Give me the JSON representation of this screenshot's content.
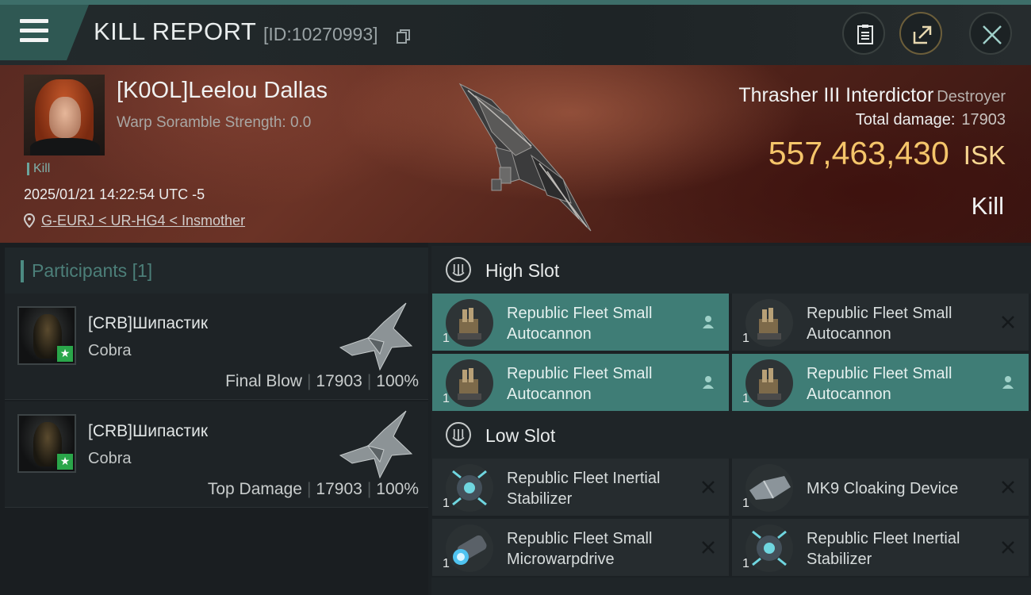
{
  "header": {
    "title": "KILL REPORT",
    "report_id": "[ID:10270993]"
  },
  "victim": {
    "pilot": "[K0OL]Leelou Dallas",
    "warp_scramble": "Warp Soramble Strength: 0.0",
    "type_tag": "Kill",
    "datetime": "2025/01/21 14:22:54 UTC -5",
    "location": "G-EURJ < UR-HG4 < Insmother",
    "ship_name": "Thrasher III Interdictor",
    "ship_class": "Destroyer",
    "total_damage_label": "Total damage:",
    "total_damage": "17903",
    "isk_value": "557,463,430",
    "isk_unit": "ISK",
    "result": "Kill"
  },
  "participants": {
    "label": "Participants",
    "count": "[1]",
    "rows": [
      {
        "pilot": "[CRB]Шипастик",
        "ship": "Cobra",
        "role": "Final Blow",
        "damage": "17903",
        "percent": "100%"
      },
      {
        "pilot": "[CRB]Шипастик",
        "ship": "Cobra",
        "role": "Top Damage",
        "damage": "17903",
        "percent": "100%"
      }
    ]
  },
  "fitting": {
    "high_slot": {
      "label": "High Slot",
      "modules": [
        {
          "name_line1": "Republic Fleet Small",
          "name_line2": "Autocannon",
          "qty": "1",
          "status": "user",
          "active": true
        },
        {
          "name_line1": "Republic Fleet Small",
          "name_line2": "Autocannon",
          "qty": "1",
          "status": "destroyed",
          "active": false
        },
        {
          "name_line1": "Republic Fleet Small",
          "name_line2": "Autocannon",
          "qty": "1",
          "status": "user",
          "active": true
        },
        {
          "name_line1": "Republic Fleet Small",
          "name_line2": "Autocannon",
          "qty": "1",
          "status": "user",
          "active": true
        }
      ]
    },
    "low_slot": {
      "label": "Low Slot",
      "modules": [
        {
          "name_line1": "Republic Fleet Inertial",
          "name_line2": "Stabilizer",
          "qty": "1",
          "status": "destroyed",
          "active": false
        },
        {
          "name_line1": "MK9 Cloaking Device",
          "name_line2": "",
          "qty": "1",
          "status": "destroyed",
          "active": false
        },
        {
          "name_line1": "Republic Fleet Small",
          "name_line2": "Microwarpdrive",
          "qty": "1",
          "status": "destroyed",
          "active": false
        },
        {
          "name_line1": "Republic Fleet Inertial",
          "name_line2": "Stabilizer",
          "qty": "1",
          "status": "destroyed",
          "active": false
        }
      ]
    }
  },
  "colors": {
    "accent": "#3f7d76",
    "isk": "#f5c56a",
    "menu": "#2f5853"
  },
  "icons": [
    "menu-icon",
    "copy-icon",
    "clipboard-icon",
    "share-icon",
    "close-icon",
    "location-pin-icon",
    "slot-icon",
    "user-icon",
    "destroyed-x-icon",
    "star-icon"
  ]
}
